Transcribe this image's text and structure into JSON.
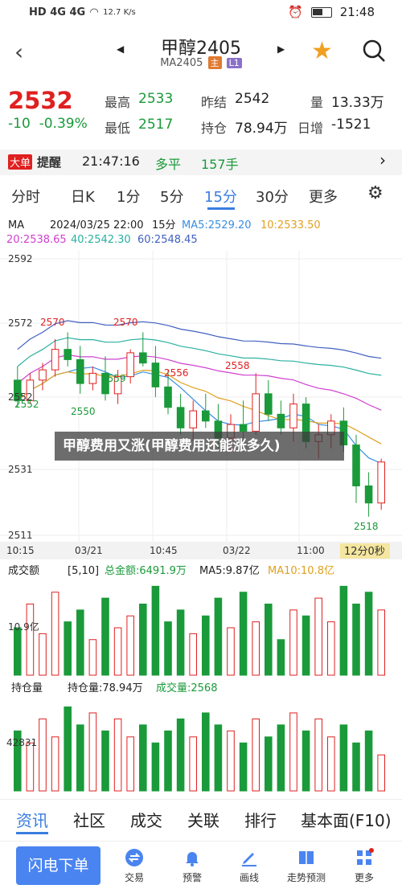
{
  "status": {
    "left": "HD 4G 4G",
    "speed": "12.7 K/s",
    "time": "21:48"
  },
  "header": {
    "title": "甲醇2405",
    "contract": "MA2405",
    "badge_main": "主",
    "badge_l1": "L1"
  },
  "quote": {
    "price": "2532",
    "change": "-10",
    "change_pct": "-0.39%",
    "high_label": "最高",
    "high": "2533",
    "low_label": "最低",
    "low": "2517",
    "prev_label": "昨结",
    "prev": "2542",
    "hold_label": "持仓",
    "hold": "78.94万",
    "vol_label": "量",
    "vol": "13.33万",
    "daily_label": "日增",
    "daily": "-1521"
  },
  "ticker": {
    "badge": "大单",
    "label": "提醒",
    "time": "21:47:16",
    "type": "多平",
    "size": "157手"
  },
  "tabs": [
    "分时",
    "日K",
    "1分",
    "5分",
    "15分",
    "30分",
    "更多"
  ],
  "active_tab": "15分",
  "chart_header": {
    "ma": "MA",
    "date": "2024/03/25 22:00",
    "period": "15分",
    "ma5": "MA5:2529.20",
    "ma10": "10:2533.50",
    "ma20": "20:2538.65",
    "ma40": "40:2542.30",
    "ma60": "60:2548.45"
  },
  "yaxis": [
    "2592",
    "2572",
    "2552",
    "2531",
    "2511"
  ],
  "annots": [
    "2570",
    "2570",
    "2559",
    "2556",
    "2558",
    "2552",
    "2550",
    "2518"
  ],
  "xaxis": [
    "10:15",
    "03/21",
    "10:45",
    "03/22",
    "11:00"
  ],
  "countdown": "12分0秒",
  "vol_header": {
    "name": "成交额",
    "param": "[5,10]",
    "total": "总金额:6491.9万",
    "ma5": "MA5:9.87亿",
    "ma10": "MA10:10.8亿"
  },
  "vol_axis": "10.9亿",
  "oi_header": {
    "name": "持仓量",
    "hold": "持仓量:78.94万",
    "deal": "成交量:2568"
  },
  "oi_axis": "42831",
  "overlay": "甲醇费用又涨(甲醇费用还能涨多久)",
  "nav": [
    "资讯",
    "社区",
    "成交",
    "关联",
    "排行",
    "基本面(F10)"
  ],
  "bottom": {
    "flash": "闪电下单",
    "items": [
      "交易",
      "预警",
      "画线",
      "走势预测",
      "更多"
    ]
  },
  "colors": {
    "up": "#e02020",
    "down": "#1a9a3a",
    "ma5": "#3a8ee0",
    "ma10": "#e0a020",
    "ma20": "#d040d0",
    "ma40": "#2ab0a0",
    "ma60": "#4060c0"
  },
  "chart_data": {
    "type": "candlestick",
    "ylim": [
      2511,
      2592
    ],
    "candles": [
      [
        2556,
        2560,
        2548,
        2550
      ],
      [
        2550,
        2558,
        2549,
        2556
      ],
      [
        2556,
        2561,
        2553,
        2559
      ],
      [
        2559,
        2568,
        2557,
        2565
      ],
      [
        2565,
        2570,
        2560,
        2562
      ],
      [
        2562,
        2566,
        2552,
        2555
      ],
      [
        2555,
        2560,
        2553,
        2558
      ],
      [
        2558,
        2563,
        2550,
        2552
      ],
      [
        2552,
        2559,
        2549,
        2557
      ],
      [
        2557,
        2565,
        2555,
        2564
      ],
      [
        2564,
        2570,
        2560,
        2561
      ],
      [
        2561,
        2566,
        2551,
        2554
      ],
      [
        2554,
        2559,
        2546,
        2548
      ],
      [
        2548,
        2552,
        2540,
        2542
      ],
      [
        2542,
        2550,
        2538,
        2547
      ],
      [
        2547,
        2552,
        2542,
        2544
      ],
      [
        2544,
        2549,
        2536,
        2539
      ],
      [
        2539,
        2546,
        2535,
        2543
      ],
      [
        2543,
        2550,
        2539,
        2541
      ],
      [
        2541,
        2558,
        2540,
        2552
      ],
      [
        2552,
        2556,
        2544,
        2546
      ],
      [
        2546,
        2550,
        2540,
        2542
      ],
      [
        2542,
        2552,
        2538,
        2549
      ],
      [
        2549,
        2551,
        2536,
        2538
      ],
      [
        2538,
        2543,
        2533,
        2540
      ],
      [
        2540,
        2546,
        2536,
        2544
      ],
      [
        2544,
        2548,
        2535,
        2537
      ],
      [
        2537,
        2540,
        2520,
        2525
      ],
      [
        2525,
        2529,
        2516,
        2520
      ],
      [
        2520,
        2533,
        2518,
        2532
      ]
    ],
    "vol": [
      8,
      12,
      7,
      14,
      9,
      11,
      6,
      13,
      8,
      10,
      12,
      15,
      9,
      11,
      7,
      10,
      13,
      8,
      14,
      9,
      12,
      6,
      11,
      10,
      13,
      9,
      15,
      12,
      14,
      11
    ],
    "oi": [
      10,
      8,
      12,
      9,
      14,
      11,
      13,
      10,
      12,
      9,
      11,
      8,
      10,
      12,
      9,
      13,
      11,
      10,
      8,
      12,
      9,
      11,
      13,
      10,
      12,
      9,
      11,
      8,
      10,
      6
    ]
  }
}
